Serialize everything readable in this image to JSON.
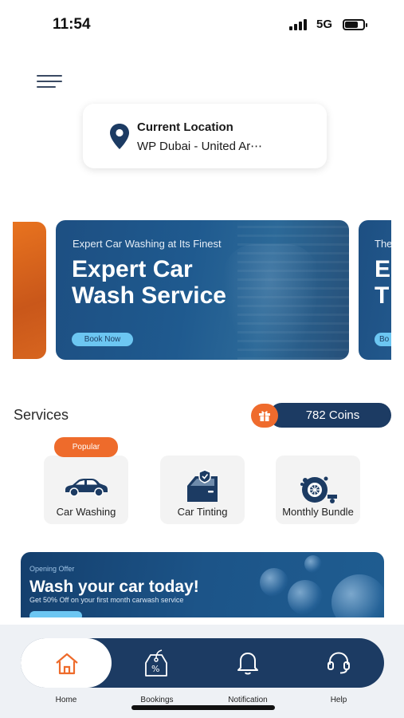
{
  "status_bar": {
    "time": "11:54",
    "network": "5G"
  },
  "location": {
    "title": "Current Location",
    "value": "WP Dubai - United Ar⋯"
  },
  "banners": [
    {
      "subtitle": "Expert Car Washing at Its Finest",
      "title_line1": "Expert Car",
      "title_line2": "Wash Service",
      "button": "Book Now"
    },
    {
      "subtitle": "The",
      "title_line1": "E",
      "title_line2": "T",
      "button": "Bo"
    }
  ],
  "services": {
    "title": "Services",
    "coins": "782 Coins",
    "popular_badge": "Popular",
    "items": [
      {
        "label": "Car Washing",
        "icon": "car-icon"
      },
      {
        "label": "Car Tinting",
        "icon": "car-door-tint-icon"
      },
      {
        "label": "Monthly Bundle",
        "icon": "wheel-service-icon"
      }
    ]
  },
  "offer": {
    "subtitle": "Opening Offer",
    "title": "Wash your car today!",
    "description": "Get 50% Off on your first month carwash service"
  },
  "nav": {
    "items": [
      {
        "label": "Home",
        "icon": "home-icon",
        "active": true
      },
      {
        "label": "Bookings",
        "icon": "bookings-tag-icon",
        "active": false
      },
      {
        "label": "Notification",
        "icon": "bell-icon",
        "active": false
      },
      {
        "label": "Help",
        "icon": "headset-icon",
        "active": false
      }
    ]
  },
  "colors": {
    "primary": "#1c3b63",
    "accent": "#ee6b2b",
    "button_light": "#6cc6f2"
  }
}
